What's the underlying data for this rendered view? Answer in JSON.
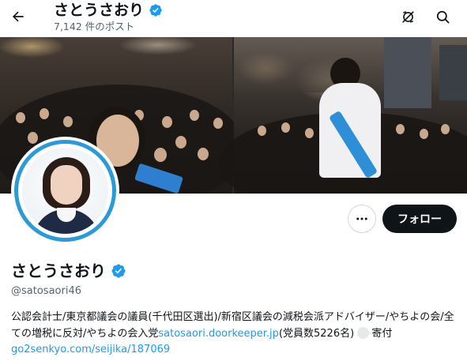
{
  "header": {
    "name": "さとうさおり",
    "post_count": "7,142 件のポスト",
    "icons": [
      "back-arrow-icon",
      "verified-badge-icon",
      "notifications-off-icon",
      "search-icon"
    ]
  },
  "profile": {
    "name": "さとうさおり",
    "handle": "@satosaori46",
    "follow_label": "フォロー",
    "more_icon": "more-horizontal-icon",
    "verified_color": "#1d9bf0"
  },
  "bio": {
    "text1": "公認会計士/東京都議会の議員(千代田区選出)/新宿区議会の減税会派アドバイザー/やちよの会/全ての増税に反対/やちよの会入党",
    "link1": "satosaori.doorkeeper.jp",
    "text2": "(党員数5226名)",
    "text3": "寄付",
    "link2": "go2senkyo.com/seijika/187069"
  },
  "colors": {
    "accent": "#1d9bf0",
    "avatar_ring": "#2c9ad6",
    "follow_bg": "#0f1419"
  }
}
